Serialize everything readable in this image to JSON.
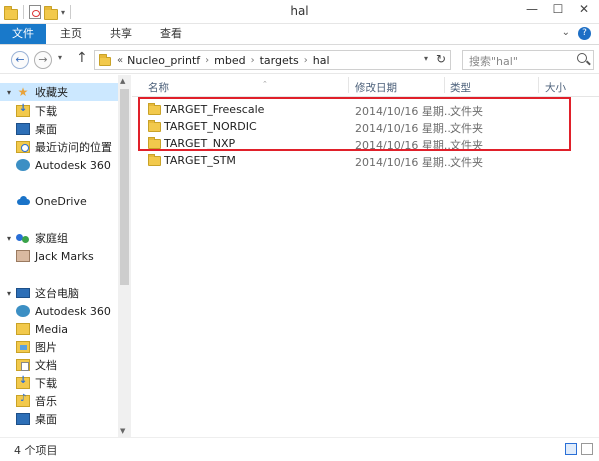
{
  "window": {
    "title": "hal",
    "min_icon": "minimize-icon",
    "max_icon": "maximize-icon",
    "close_icon": "close-icon"
  },
  "ribbon": {
    "tabs": [
      {
        "label": "文件",
        "active": true
      },
      {
        "label": "主页"
      },
      {
        "label": "共享"
      },
      {
        "label": "查看"
      }
    ]
  },
  "address": {
    "overflow": "«",
    "crumbs": [
      "Nucleo_printf",
      "mbed",
      "targets",
      "hal"
    ]
  },
  "search": {
    "placeholder": "搜索\"hal\""
  },
  "nav": {
    "items": [
      {
        "label": "收藏夹",
        "icon": "star-icon"
      },
      {
        "label": "下载",
        "icon": "downloads-icon"
      },
      {
        "label": "桌面",
        "icon": "desktop-icon"
      },
      {
        "label": "最近访问的位置",
        "icon": "recent-places-icon"
      },
      {
        "label": "Autodesk 360",
        "icon": "autodesk-icon"
      },
      {
        "label": "OneDrive",
        "icon": "onedrive-icon"
      },
      {
        "label": "家庭组",
        "icon": "homegroup-icon"
      },
      {
        "label": "Jack Marks",
        "icon": "user-icon"
      },
      {
        "label": "这台电脑",
        "icon": "computer-icon"
      },
      {
        "label": "Autodesk 360",
        "icon": "autodesk-icon"
      },
      {
        "label": "Media",
        "icon": "folder-icon"
      },
      {
        "label": "图片",
        "icon": "pictures-icon"
      },
      {
        "label": "文档",
        "icon": "documents-icon"
      },
      {
        "label": "下载",
        "icon": "downloads-icon"
      },
      {
        "label": "音乐",
        "icon": "music-icon"
      },
      {
        "label": "桌面",
        "icon": "desktop-icon"
      }
    ]
  },
  "columns": {
    "name": "名称",
    "date": "修改日期",
    "type": "类型",
    "size": "大小"
  },
  "files": [
    {
      "name": "TARGET_Freescale",
      "date": "2014/10/16 星期...",
      "type": "文件夹"
    },
    {
      "name": "TARGET_NORDIC",
      "date": "2014/10/16 星期...",
      "type": "文件夹"
    },
    {
      "name": "TARGET_NXP",
      "date": "2014/10/16 星期...",
      "type": "文件夹"
    },
    {
      "name": "TARGET_STM",
      "date": "2014/10/16 星期...",
      "type": "文件夹"
    }
  ],
  "status": {
    "count": "4 个项目"
  },
  "colors": {
    "file_tab": "#1979ca",
    "highlight_box": "#e0202a",
    "folder": "#f2c94c"
  }
}
